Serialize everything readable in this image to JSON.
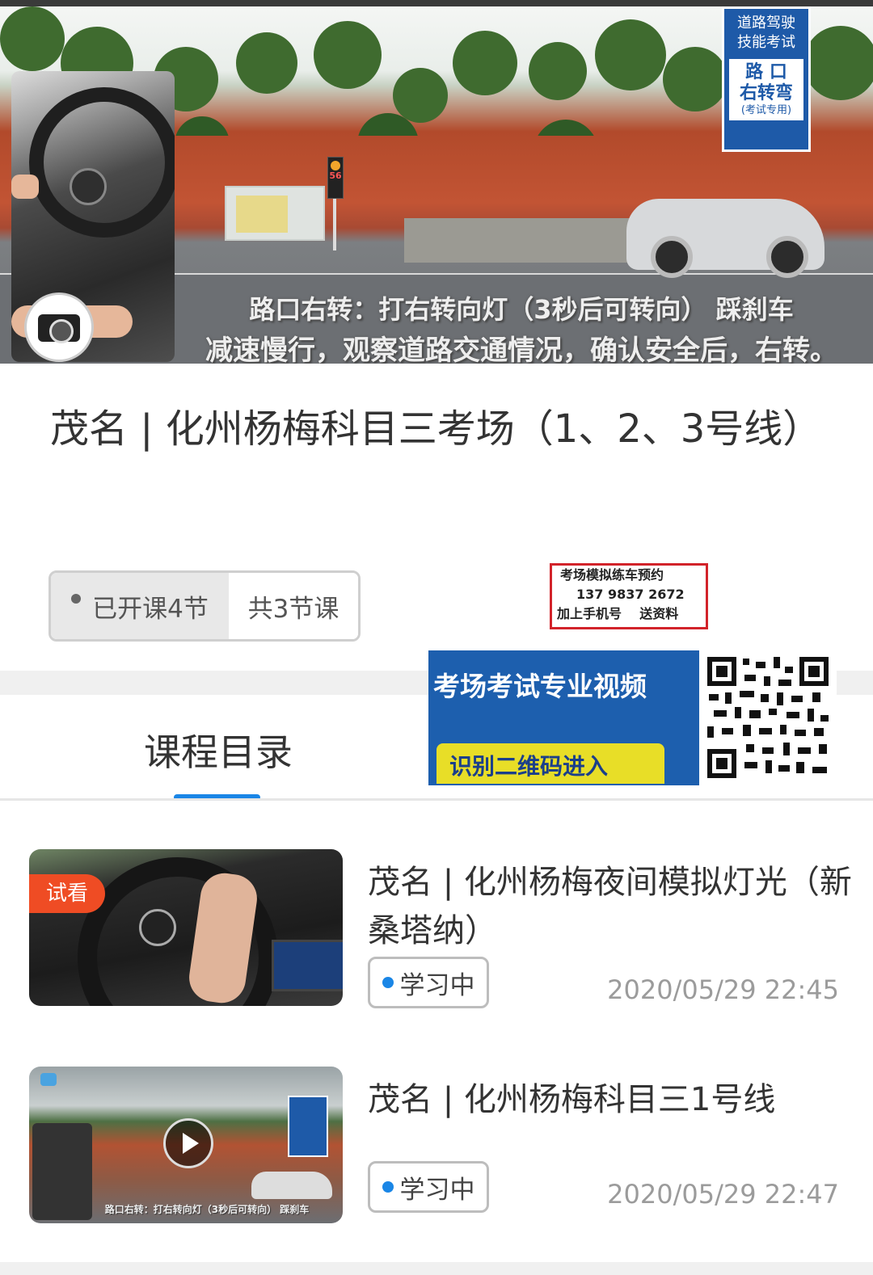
{
  "hero": {
    "inset_label": "",
    "traffic_light_number": "56",
    "sign": {
      "top": "道路驾驶\n技能考试",
      "main_line1": "路 口",
      "main_line2": "右转弯",
      "note": "(考试专用)"
    },
    "caption_line1": "路口右转：打右转向灯（3秒后可转向） 踩刹车",
    "caption_line2": "减速慢行，观察道路交通情况，确认安全后，右转。"
  },
  "course": {
    "title": "茂名 | 化州杨梅科目三考场（1、2、3号线）",
    "opened_lessons": "已开课4节",
    "total_lessons": "共3节课"
  },
  "ad_box": {
    "line1": "考场模拟练车预约",
    "line2": "137 9837 2672",
    "line3": "加上手机号    送资料"
  },
  "promo": {
    "title": "考场考试专业视频",
    "button": "识别二维码进入"
  },
  "tabs": {
    "catalog": "课程目录"
  },
  "lessons": [
    {
      "badge": "试看",
      "title": "茂名 | 化州杨梅夜间模拟灯光（新桑塔纳）",
      "status": "学习中",
      "time": "2020/05/29 22:45"
    },
    {
      "badge": "",
      "title": "茂名 | 化州杨梅科目三1号线",
      "status": "学习中",
      "time": "2020/05/29 22:47",
      "thumb_caption": "路口右转：打右转向灯（3秒后可转向） 踩刹车"
    }
  ],
  "colors": {
    "accent": "#1a86e6",
    "badge": "#ef4c24",
    "promo_bg": "#1d5fae",
    "promo_button": "#e8de27",
    "ad_border": "#d2232a"
  },
  "icons": [
    "camera-icon",
    "play-icon",
    "cloud-icon",
    "status-dot-icon"
  ]
}
